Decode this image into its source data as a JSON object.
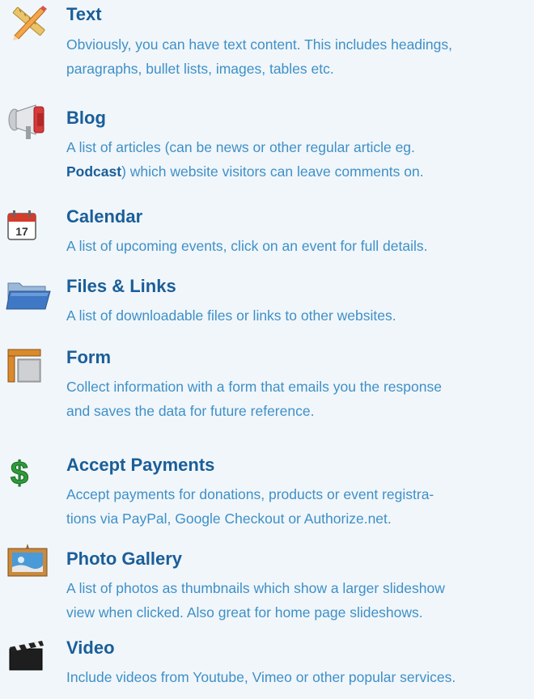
{
  "features": [
    {
      "title": "Text",
      "icon": "pencil-ruler-icon",
      "desc_lines": [
        "Obviously, you can have text content.  This includes headings,",
        "paragraphs, bullet lists, images, tables etc."
      ]
    },
    {
      "title": "Blog",
      "icon": "megaphone-icon",
      "desc_line1": "A list of articles (can be news or other regular article eg.",
      "desc_bold": "Podcast",
      "desc_line2_rest": ") which website visitors can leave comments on."
    },
    {
      "title": "Calendar",
      "icon": "calendar-icon",
      "calendar_day": "17",
      "desc_lines": [
        "A list of upcoming events, click on an event for full details."
      ]
    },
    {
      "title": "Files & Links",
      "icon": "folder-icon",
      "desc_lines": [
        "A list of downloadable files or links to other websites."
      ]
    },
    {
      "title": "Form",
      "icon": "form-icon",
      "desc_lines": [
        "Collect information with a form that emails you the response",
        "and saves the data for future reference."
      ]
    },
    {
      "title": "Accept Payments",
      "icon": "dollar-icon",
      "desc_lines": [
        "Accept payments for donations, products or event registra-",
        "tions via PayPal, Google Checkout or Authorize.net."
      ]
    },
    {
      "title": "Photo Gallery",
      "icon": "picture-frame-icon",
      "desc_lines": [
        "A list of photos as thumbnails which show a larger slideshow",
        "view when clicked. Also great for home page slideshows."
      ]
    },
    {
      "title": "Video",
      "icon": "clapperboard-icon",
      "desc_lines": [
        "Include videos from Youtube, Vimeo or other popular services."
      ]
    }
  ]
}
